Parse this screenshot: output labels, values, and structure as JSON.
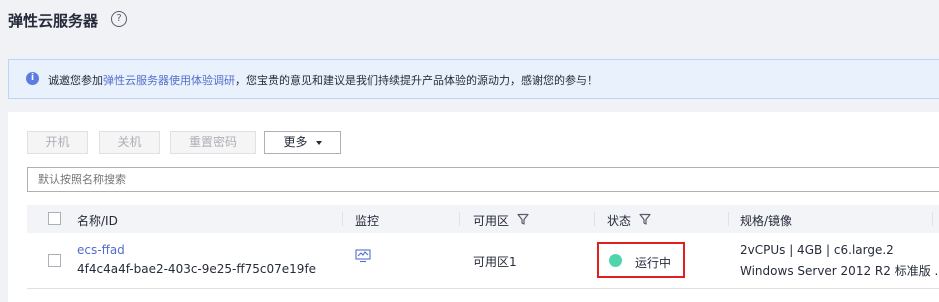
{
  "header": {
    "title": "弹性云服务器",
    "help_icon": "?"
  },
  "notice": {
    "icon": "i",
    "text_before": "诚邀您参加",
    "link_text": "弹性云服务器使用体验调研",
    "text_after": "，您宝贵的意见和建议是我们持续提升产品体验的源动力，感谢您的参与！"
  },
  "toolbar": {
    "start_label": "开机",
    "stop_label": "关机",
    "reset_password_label": "重置密码",
    "more_label": "更多"
  },
  "search": {
    "placeholder": "默认按照名称搜索"
  },
  "table": {
    "columns": {
      "name": "名称/ID",
      "monitor": "监控",
      "zone": "可用区",
      "status": "状态",
      "spec": "规格/镜像"
    },
    "rows": [
      {
        "name": "ecs-ffad",
        "id": "4f4c4a4f-bae2-403c-9e25-ff75c07e19fe",
        "zone": "可用区1",
        "status": "运行中",
        "spec": "2vCPUs | 4GB | c6.large.2",
        "image": "Windows Server 2012 R2 标准版 ..."
      }
    ]
  },
  "colors": {
    "link": "#526ecc",
    "running": "#50d4ab",
    "highlight": "#e02020"
  }
}
